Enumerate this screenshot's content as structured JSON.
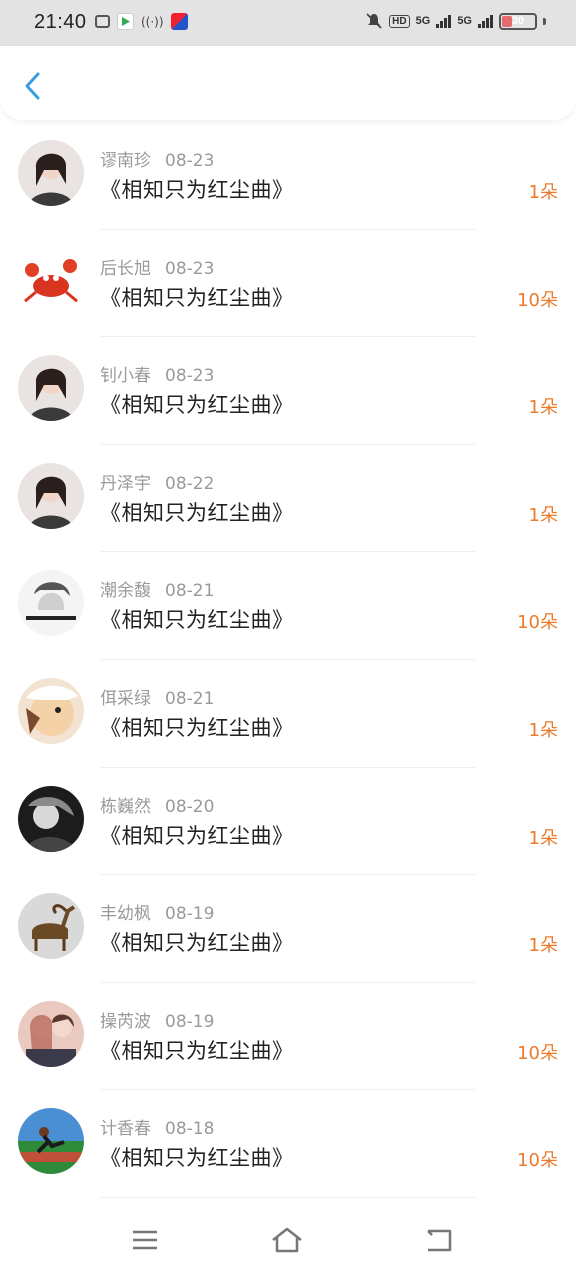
{
  "status_bar": {
    "time": "21:40",
    "network": "5G",
    "network2": "5G",
    "hd": "HD",
    "battery_level": "30",
    "battery_fraction": 0.3,
    "battery_color": "#e66a6a"
  },
  "header": {
    "back_icon": "back-chevron-icon",
    "accent": "#3a9ee0"
  },
  "records": [
    {
      "user": "谬南珍",
      "date": "08-23",
      "song": "《相知只为红尘曲》",
      "count": "1朵",
      "avatar": "girl-avatar"
    },
    {
      "user": "后长旭",
      "date": "08-23",
      "song": "《相知只为红尘曲》",
      "count": "10朵",
      "avatar": "crab-avatar"
    },
    {
      "user": "钊小春",
      "date": "08-23",
      "song": "《相知只为红尘曲》",
      "count": "1朵",
      "avatar": "girl-avatar"
    },
    {
      "user": "丹泽宇",
      "date": "08-22",
      "song": "《相知只为红尘曲》",
      "count": "1朵",
      "avatar": "girl-avatar"
    },
    {
      "user": "潮余馥",
      "date": "08-21",
      "song": "《相知只为红尘曲》",
      "count": "10朵",
      "avatar": "sketch-avatar"
    },
    {
      "user": "佴采绿",
      "date": "08-21",
      "song": "《相知只为红尘曲》",
      "count": "1朵",
      "avatar": "cartoon-avatar"
    },
    {
      "user": "栋巍然",
      "date": "08-20",
      "song": "《相知只为红尘曲》",
      "count": "1朵",
      "avatar": "bw-photo-avatar"
    },
    {
      "user": "丰幼枫",
      "date": "08-19",
      "song": "《相知只为红尘曲》",
      "count": "1朵",
      "avatar": "goat-statue-avatar"
    },
    {
      "user": "操芮波",
      "date": "08-19",
      "song": "《相知只为红尘曲》",
      "count": "10朵",
      "avatar": "anime-couple-avatar"
    },
    {
      "user": "计香春",
      "date": "08-18",
      "song": "《相知只为红尘曲》",
      "count": "10朵",
      "avatar": "runner-avatar"
    }
  ],
  "colors": {
    "count": "#ec7a2b",
    "name": "#9a9a9a",
    "song": "#222222"
  },
  "nav_bar": {
    "menu_icon": "menu-icon",
    "home_icon": "home-icon",
    "back_icon": "back-icon"
  }
}
